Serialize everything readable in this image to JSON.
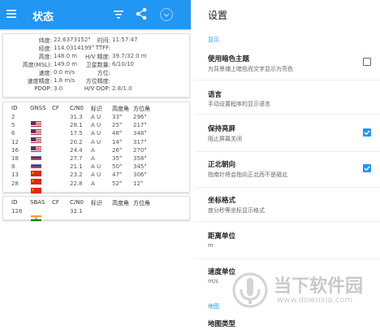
{
  "status_panel": {
    "title": "状态",
    "position": {
      "lat_label": "纬度:",
      "lat": "22.6373152°",
      "lon_label": "经度:",
      "lon": "114.0314199°",
      "alt_label": "高度:",
      "alt": "148.0 m",
      "msl_label": "高度(MSL):",
      "msl": "149.0 m",
      "speed_label": "速度:",
      "speed": "0.0 m/s",
      "speed_acc_label": "速度精度:",
      "speed_acc": "1.8 m/s",
      "pdop_label": "PDOP:",
      "pdop": "3.0",
      "time_label": "时间:",
      "time": "11:57:47",
      "ttff_label": "TTFF:",
      "ttff": "",
      "hv_acc_label": "H/V 精度:",
      "hv_acc": "39.7/32.0 m",
      "sats_label": "卫星数量:",
      "sats": "6/10/10",
      "bearing_label": "方位:",
      "bearing": "",
      "bearing_acc_label": "方位精度:",
      "bearing_acc": "",
      "hvdop_label": "H/V DOP:",
      "hvdop": "2.8/1.0"
    },
    "gnss_table": {
      "headers": [
        "ID",
        "GNSS",
        "CF",
        "C/N0",
        "标识",
        "高度角",
        "方位角"
      ],
      "rows": [
        {
          "id": "2",
          "flag": "us",
          "cn0": "31.3",
          "flags": "A U",
          "elev": "33°",
          "azim": "296°"
        },
        {
          "id": "5",
          "flag": "us",
          "cn0": "28.1",
          "flags": "A U",
          "elev": "25°",
          "azim": "217°"
        },
        {
          "id": "6",
          "flag": "us",
          "cn0": "17.5",
          "flags": "A U",
          "elev": "48°",
          "azim": "348°"
        },
        {
          "id": "12",
          "flag": "us",
          "cn0": "20.2",
          "flags": "A U",
          "elev": "14°",
          "azim": "317°"
        },
        {
          "id": "16",
          "flag": "ru",
          "cn0": "24.4",
          "flags": "A",
          "elev": "26°",
          "azim": "270°"
        },
        {
          "id": "18",
          "flag": "ru",
          "cn0": "27.7",
          "flags": "A",
          "elev": "35°",
          "azim": "358°"
        },
        {
          "id": "8",
          "flag": "cn",
          "cn0": "21.1",
          "flags": "A U",
          "elev": "50°",
          "azim": "345°"
        },
        {
          "id": "13",
          "flag": "cn",
          "cn0": "23.2",
          "flags": "A U",
          "elev": "47°",
          "azim": "306°"
        },
        {
          "id": "28",
          "flag": "cn",
          "cn0": "22.8",
          "flags": "A",
          "elev": "52°",
          "azim": "12°"
        }
      ]
    },
    "sbas_table": {
      "headers": [
        "ID",
        "SBAS",
        "CF",
        "C/N0",
        "标识",
        "高度角",
        "方位角"
      ],
      "rows": [
        {
          "id": "128",
          "flag": "in",
          "cn0": "32.1"
        }
      ]
    }
  },
  "settings_panel": {
    "title": "设置",
    "sections": {
      "display": "显示",
      "map": "地图"
    },
    "items": [
      {
        "title": "使用暗色主题",
        "sub": "为背景铺上暗色而文字显示为亮色",
        "checked": false
      },
      {
        "title": "语言",
        "sub": "手动设置程序的显示语言"
      },
      {
        "title": "保持亮屏",
        "sub": "阻止屏幕关闭",
        "checked": true
      },
      {
        "title": "正北朝向",
        "sub": "指南针将会指向正北而不是磁北",
        "checked": true
      },
      {
        "title": "坐标格式",
        "sub": "度分秒等坐标显示格式"
      },
      {
        "title": "距离单位",
        "sub": "m"
      },
      {
        "title": "速度单位",
        "sub": "m/s"
      },
      {
        "title": "地图类型",
        "sub": ""
      }
    ]
  },
  "watermark": {
    "brand": "当下软件园",
    "url": "www.downxia.com"
  },
  "colors": {
    "primary": "#2196f3",
    "us_red": "#b22234",
    "ru_blue": "#0039a6",
    "cn_red": "#de2910"
  }
}
